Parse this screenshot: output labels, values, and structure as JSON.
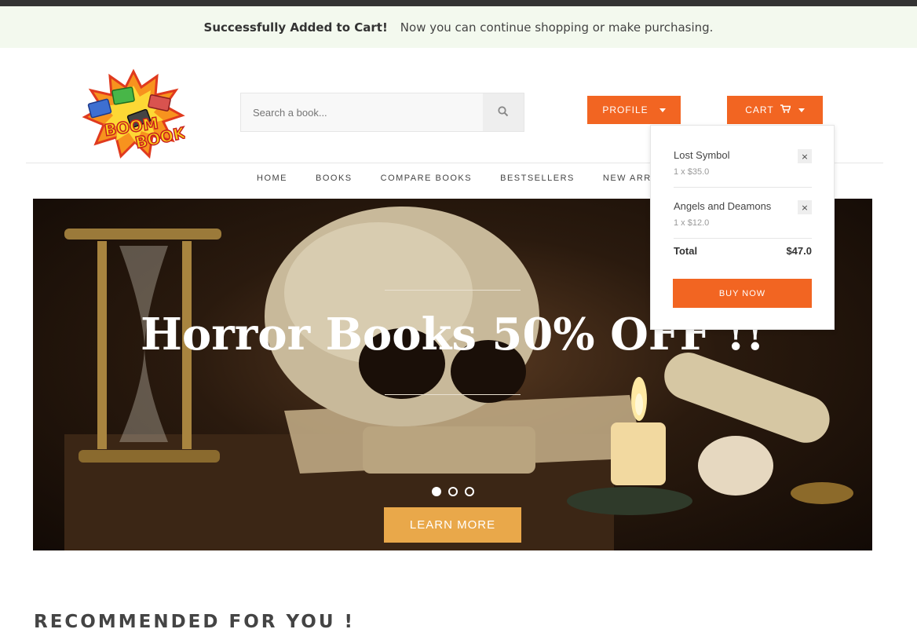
{
  "alert": {
    "title": "Successfully Added to Cart!",
    "message": "Now you can continue shopping or make purchasing."
  },
  "logo": {
    "line1": "BOOM",
    "line2": "BOOK"
  },
  "search": {
    "placeholder": "Search a book...",
    "icon": "search-icon"
  },
  "header": {
    "profile_label": "PROFILE",
    "cart_label": "CART"
  },
  "nav": [
    "HOME",
    "BOOKS",
    "COMPARE BOOKS",
    "BESTSELLERS",
    "NEW ARRIVALS"
  ],
  "hero": {
    "title": "Horror Books 50% OFF !!",
    "button": "LEARN MORE",
    "slide_count": 3,
    "active_slide": 1
  },
  "cart": {
    "items": [
      {
        "name": "Lost Symbol",
        "qty_price": "1 x $35.0",
        "remove": "×"
      },
      {
        "name": "Angels and Deamons",
        "qty_price": "1 x $12.0",
        "remove": "×"
      }
    ],
    "total_label": "Total",
    "total_value": "$47.0",
    "buy_label": "BUY NOW"
  },
  "section": {
    "recommended_title": "RECOMMENDED FOR YOU !"
  },
  "colors": {
    "accent": "#f26522",
    "learn_more": "#e9a84a",
    "alert_bg": "#f3f9ee"
  }
}
